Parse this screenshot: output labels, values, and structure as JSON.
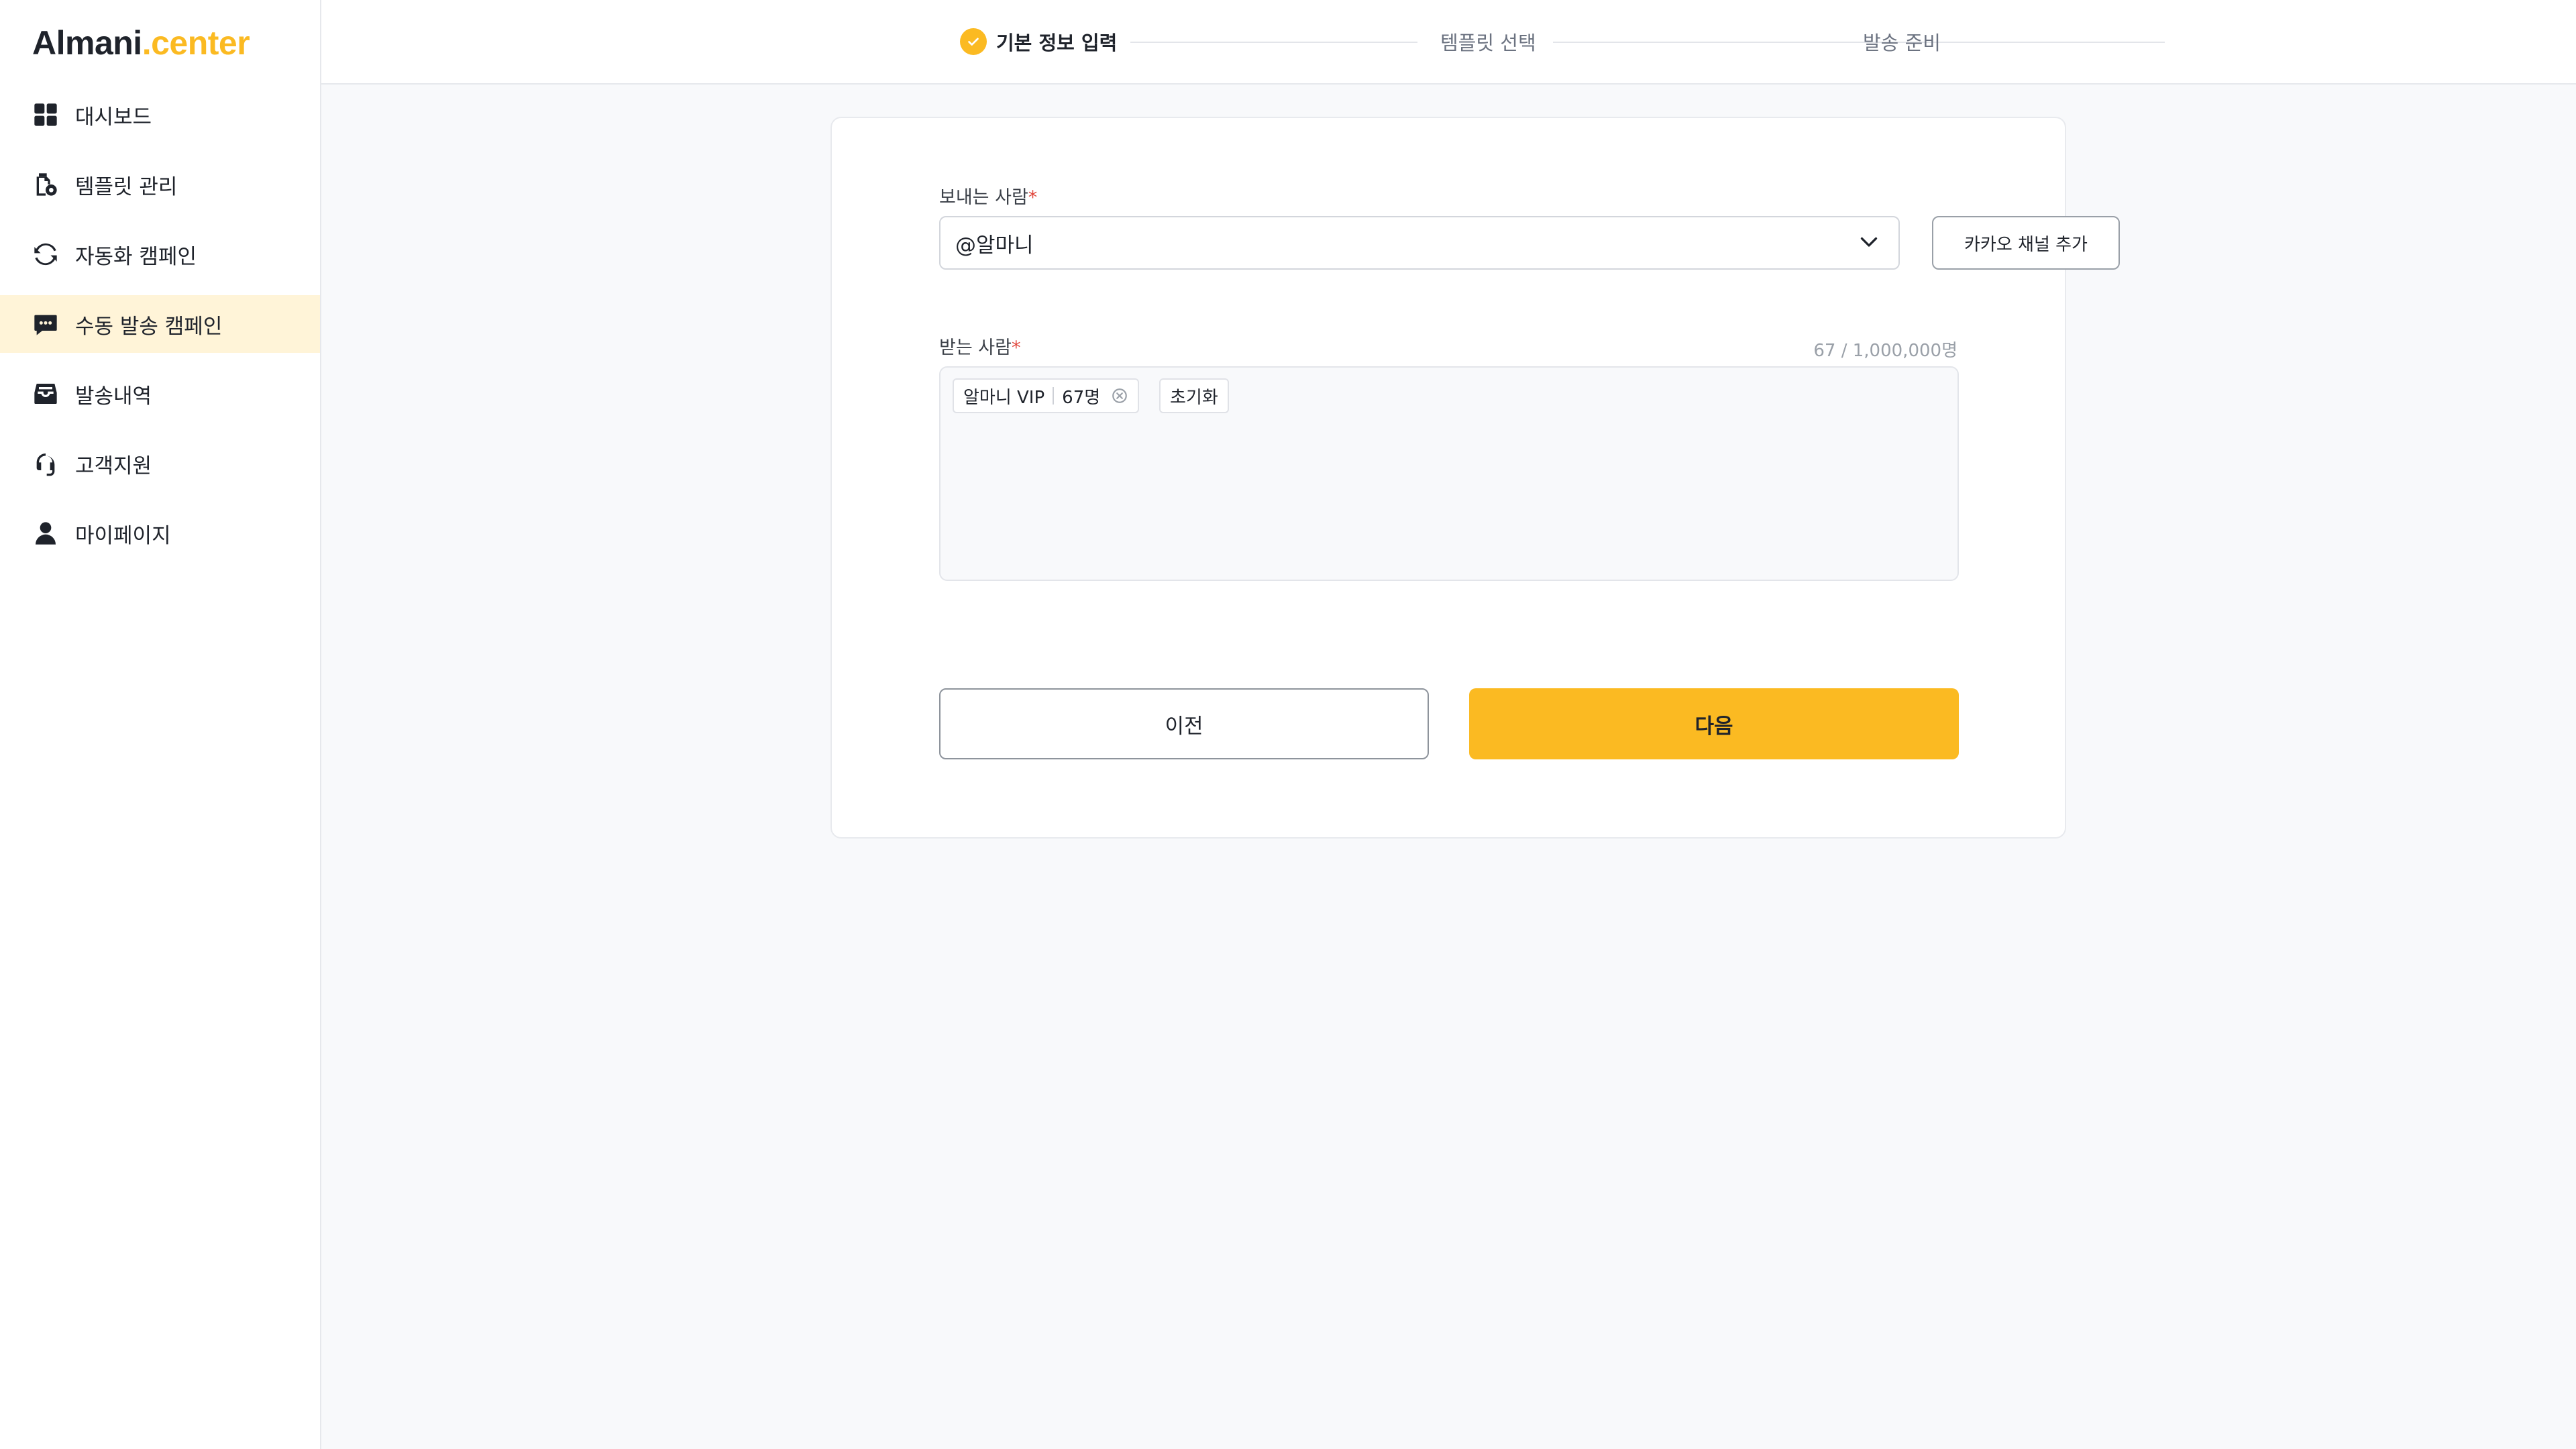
{
  "brand": {
    "name_main": "Almani",
    "name_accent": ".center",
    "accent_color": "#fbba22"
  },
  "sidebar": {
    "items": [
      {
        "label": "대시보드",
        "icon": "dashboard-icon",
        "active": false
      },
      {
        "label": "템플릿 관리",
        "icon": "template-settings-icon",
        "active": false
      },
      {
        "label": "자동화 캠페인",
        "icon": "sync-icon",
        "active": false
      },
      {
        "label": "수동 발송 캠페인",
        "icon": "chat-message-icon",
        "active": true
      },
      {
        "label": "발송내역",
        "icon": "inbox-icon",
        "active": false
      },
      {
        "label": "고객지원",
        "icon": "headset-icon",
        "active": false
      },
      {
        "label": "마이페이지",
        "icon": "user-icon",
        "active": false
      }
    ]
  },
  "stepper": {
    "steps": [
      {
        "label": "기본 정보 입력",
        "state": "completed"
      },
      {
        "label": "템플릿 선택",
        "state": "pending"
      },
      {
        "label": "발송 준비",
        "state": "pending"
      }
    ]
  },
  "form": {
    "sender": {
      "label": "보내는 사람",
      "required_mark": "*",
      "value": "@알마니",
      "add_channel_label": "카카오 채널 추가"
    },
    "recipients": {
      "label": "받는 사람",
      "required_mark": "*",
      "count_text": "67 / 1,000,000명",
      "chips": [
        {
          "name": "알마니 VIP",
          "count": "67명"
        }
      ],
      "reset_label": "초기화"
    },
    "buttons": {
      "prev_label": "이전",
      "next_label": "다음"
    }
  }
}
